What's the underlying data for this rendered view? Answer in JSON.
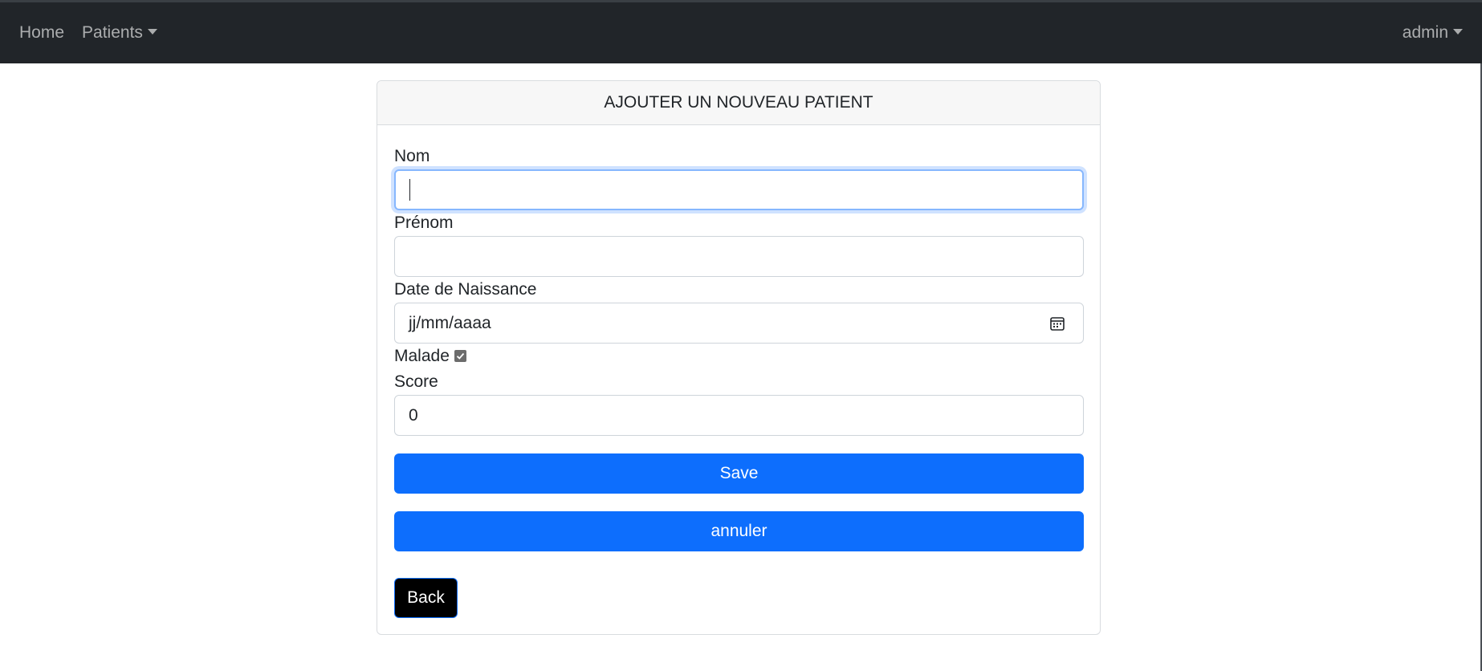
{
  "navbar": {
    "home_label": "Home",
    "patients_label": "Patients",
    "user_label": "admin"
  },
  "card": {
    "title": "AJOUTER UN NOUVEAU PATIENT"
  },
  "form": {
    "nom": {
      "label": "Nom",
      "value": ""
    },
    "prenom": {
      "label": "Prénom",
      "value": ""
    },
    "date_naissance": {
      "label": "Date de Naissance",
      "placeholder": "jj/mm/aaaa"
    },
    "malade": {
      "label": "Malade",
      "checked": true
    },
    "score": {
      "label": "Score",
      "value": "0"
    }
  },
  "buttons": {
    "save_label": "Save",
    "cancel_label": "annuler",
    "back_label": "Back"
  },
  "colors": {
    "navbar_bg": "#212529",
    "primary": "#0d6efd",
    "back_bg": "#000000"
  },
  "icons": {
    "calendar": "calendar-icon",
    "checkbox": "checkmark-icon"
  }
}
